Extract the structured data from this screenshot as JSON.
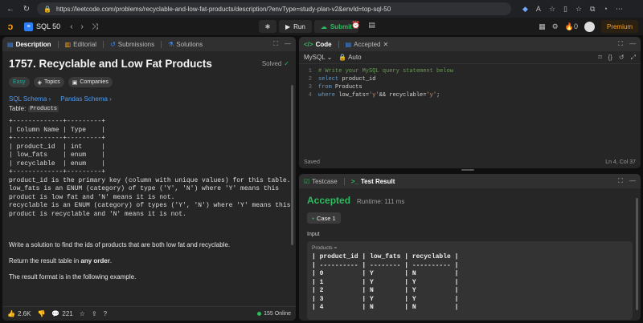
{
  "browser": {
    "url": "https://leetcode.com/problems/recyclable-and-low-fat-products/description/?envType=study-plan-v2&envId=top-sql-50"
  },
  "header": {
    "list_name": "SQL 50",
    "run_label": "Run",
    "submit_label": "Submit",
    "counter": "0",
    "premium_label": "Premium"
  },
  "left": {
    "tabs": [
      "Description",
      "Editorial",
      "Submissions",
      "Solutions"
    ],
    "title": "1757. Recyclable and Low Fat Products",
    "solved": "Solved",
    "chips": [
      "Easy",
      "Topics",
      "Companies"
    ],
    "schema_links": [
      "SQL Schema",
      "Pandas Schema"
    ],
    "table_prefix": "Table:",
    "table_name": "Products",
    "schema_table": "+-------------+---------+\n| Column Name | Type    |\n+-------------+---------+\n| product_id  | int     |\n| low_fats    | enum    |\n| recyclable  | enum    |\n+-------------+---------+\nproduct_id is the primary key (column with unique values) for this table.\nlow_fats is an ENUM (category) of type ('Y', 'N') where 'Y' means this\nproduct is low fat and 'N' means it is not.\nrecyclable is an ENUM (category) of types ('Y', 'N') where 'Y' means this\nproduct is recyclable and 'N' means it is not.",
    "desc1": "Write a solution to find the ids of products that are both low fat and recyclable.",
    "desc2_pre": "Return the result table in ",
    "desc2_bold": "any order",
    "desc2_post": ".",
    "desc3": "The result format is in the following example.",
    "footer": {
      "likes": "2.6K",
      "comments": "221",
      "online": "155 Online"
    }
  },
  "code": {
    "tab_code": "Code",
    "tab_accepted": "Accepted",
    "language": "MySQL",
    "auto": "Auto",
    "lines": [
      {
        "n": "1",
        "parts": [
          {
            "t": "# Write your MySQL query statement below",
            "c": "c-comment"
          }
        ]
      },
      {
        "n": "2",
        "parts": [
          {
            "t": "select",
            "c": "c-kw"
          },
          {
            "t": " product_id",
            "c": "c-plain"
          }
        ]
      },
      {
        "n": "3",
        "parts": [
          {
            "t": "from",
            "c": "c-kw"
          },
          {
            "t": " Products",
            "c": "c-plain"
          }
        ]
      },
      {
        "n": "4",
        "parts": [
          {
            "t": "where",
            "c": "c-kw"
          },
          {
            "t": " low_fats=",
            "c": "c-plain"
          },
          {
            "t": "'y'",
            "c": "c-str"
          },
          {
            "t": "&& recyclable=",
            "c": "c-plain"
          },
          {
            "t": "'y'",
            "c": "c-str"
          },
          {
            "t": ";",
            "c": "c-plain"
          }
        ]
      }
    ],
    "status_left": "Saved",
    "status_right": "Ln 4, Col 37"
  },
  "result": {
    "tab_testcase": "Testcase",
    "tab_result": "Test Result",
    "status": "Accepted",
    "runtime": "Runtime: 111 ms",
    "case": "Case 1",
    "input_label": "Input",
    "input_key": "Products =",
    "input_table": "| product_id | low_fats | recyclable |\n| ---------- | -------- | ---------- |\n| 0          | Y        | N          |\n| 1          | Y        | Y          |\n| 2          | N        | Y          |\n| 3          | Y        | Y          |\n| 4          | N        | N          |"
  },
  "colors": {
    "accent": "#ffa116",
    "accepted": "#2cbb5d",
    "link": "#4a9df8",
    "easy": "#00b8a3"
  }
}
